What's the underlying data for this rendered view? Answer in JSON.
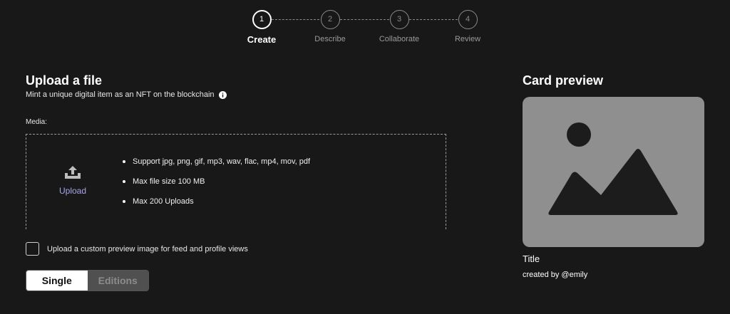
{
  "stepper": {
    "steps": [
      {
        "number": "1",
        "label": "Create",
        "active": true
      },
      {
        "number": "2",
        "label": "Describe",
        "active": false
      },
      {
        "number": "3",
        "label": "Collaborate",
        "active": false
      },
      {
        "number": "4",
        "label": "Review",
        "active": false
      }
    ]
  },
  "upload": {
    "title": "Upload a file",
    "subtitle": "Mint a unique digital item as an NFT on the blockchain",
    "media_label": "Media:",
    "button_label": "Upload",
    "requirements": [
      "Support jpg, png, gif, mp3, wav, flac, mp4, mov, pdf",
      "Max file size 100 MB",
      "Max 200 Uploads"
    ],
    "custom_preview_checkbox": {
      "label": "Upload a custom preview image for feed and profile views",
      "checked": false
    },
    "edition_toggle": {
      "options": [
        "Single",
        "Editions"
      ],
      "selected": "Single"
    }
  },
  "preview": {
    "title": "Card preview",
    "card_title": "Title",
    "creator": "created by @emily",
    "placeholder_color": "#8f8f8f"
  },
  "colors": {
    "background": "#181818",
    "accent_upload": "#a9a6e8",
    "placeholder_dark": "#1c1c1c"
  }
}
